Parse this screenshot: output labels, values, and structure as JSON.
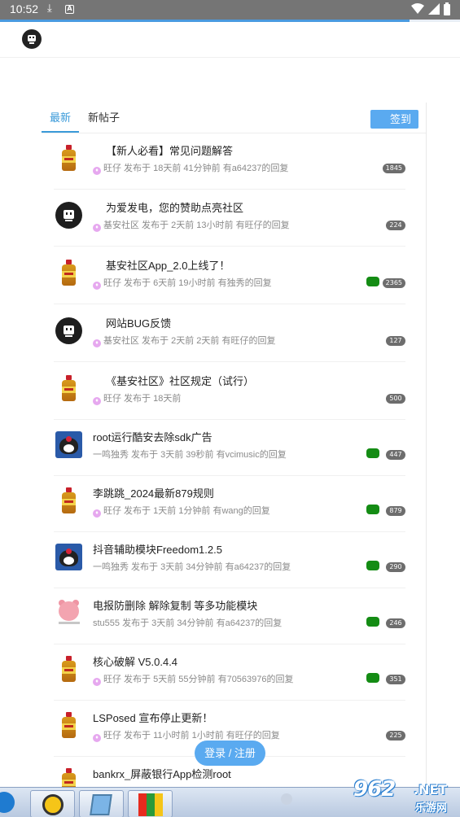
{
  "status_bar": {
    "time": "10:52"
  },
  "page_load_progress": 0.89,
  "tabs": [
    {
      "label": "最新",
      "active": true
    },
    {
      "label": "新帖子",
      "active": false
    }
  ],
  "signin_label": "签到",
  "posts": [
    {
      "avatar": "bottle",
      "title": "【新人必看】常见问题解答",
      "meta": "旺仔  发布于 18天前 41分钟前 有a64237的回复",
      "count": "1845",
      "hot": false,
      "gem": true
    },
    {
      "avatar": "robot",
      "title": "为爱发电，您的赞助点亮社区",
      "meta": "基安社区  发布于 2天前 13小时前 有旺仔的回复",
      "count": "224",
      "hot": false,
      "gem": true
    },
    {
      "avatar": "bottle",
      "title": "基安社区App_2.0上线了！",
      "meta": "旺仔  发布于 6天前 19小时前 有独秀的回复",
      "count": "2365",
      "hot": true,
      "gem": true
    },
    {
      "avatar": "robot",
      "title": "网站BUG反馈",
      "meta": "基安社区  发布于 2天前 2天前 有旺仔的回复",
      "count": "127",
      "hot": false,
      "gem": true
    },
    {
      "avatar": "bottle",
      "title": "《基安社区》社区规定（试行）",
      "meta": "旺仔  发布于 18天前",
      "count": "500",
      "hot": false,
      "gem": true
    },
    {
      "avatar": "kuromi",
      "title": "root运行酷安去除sdk广告",
      "meta": "一鸣独秀  发布于 3天前 39秒前 有vcimusic的回复",
      "count": "447",
      "hot": true,
      "gem": false
    },
    {
      "avatar": "bottle",
      "title": "李跳跳_2024最新879规则",
      "meta": "旺仔  发布于 1天前 1分钟前 有wang的回复",
      "count": "879",
      "hot": true,
      "gem": true
    },
    {
      "avatar": "kuromi",
      "title": "抖音辅助模块Freedom1.2.5",
      "meta": "一鸣独秀  发布于 3天前 34分钟前 有a64237的回复",
      "count": "290",
      "hot": true,
      "gem": false
    },
    {
      "avatar": "bear",
      "title": "电报防删除 解除复制 等多功能模块",
      "meta": "stu555  发布于 3天前 34分钟前 有a64237的回复",
      "count": "246",
      "hot": true,
      "gem": false
    },
    {
      "avatar": "bottle",
      "title": "核心破解 V5.0.4.4",
      "meta": "旺仔  发布于 5天前 55分钟前 有70563976的回复",
      "count": "351",
      "hot": true,
      "gem": true
    },
    {
      "avatar": "bottle",
      "title": "LSPosed 宣布停止更新！",
      "meta": "旺仔  发布于 11小时前 1小时前 有旺仔的回复",
      "count": "225",
      "hot": false,
      "gem": true
    },
    {
      "avatar": "bottle",
      "title": "bankrx_屏蔽银行App检测root",
      "meta": "",
      "count": "",
      "hot": false,
      "gem": false
    }
  ],
  "login_label": "登录 / 注册",
  "watermark": {
    "number": "962",
    "suffix": ".NET",
    "subtitle": "乐游网"
  }
}
